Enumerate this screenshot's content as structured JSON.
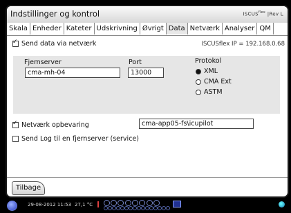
{
  "window": {
    "title": "Indstillinger og kontrol",
    "brand": "ISCUS",
    "brand_sup": "flex",
    "brand_suffix": "|Rev L"
  },
  "tabs": [
    {
      "label": "Skala",
      "active": false
    },
    {
      "label": "Enheder",
      "active": false
    },
    {
      "label": "Kateter",
      "active": false
    },
    {
      "label": "Udskrivning",
      "active": false
    },
    {
      "label": "Øvrigt",
      "active": false
    },
    {
      "label": "Data",
      "active": true
    },
    {
      "label": "Netværk",
      "active": false
    },
    {
      "label": "Analyser",
      "active": false
    },
    {
      "label": "QM",
      "active": false
    }
  ],
  "network": {
    "send_data_label": "Send data via netværk",
    "send_data_checked": true,
    "ip_info": "ISCUSflex IP = 192.168.0.68",
    "server_label": "Fjernserver",
    "server_value": "cma-mh-04",
    "port_label": "Port",
    "port_value": "13000",
    "protocol_label": "Protokol",
    "protocols": [
      {
        "label": "XML",
        "selected": true
      },
      {
        "label": "CMA Ext",
        "selected": false
      },
      {
        "label": "ASTM",
        "selected": false
      }
    ],
    "storage_label": "Netværk opbevaring",
    "storage_checked": true,
    "storage_value": "cma-app05-fs\\icupilot",
    "send_log_label": "Send Log til en fjernserver (service)",
    "send_log_checked": false
  },
  "footer": {
    "back_label": "Tilbage"
  },
  "statusbar": {
    "datetime": "29-08-2012 11:53",
    "temperature": "27,1 °C",
    "alarm_color": "#e04040"
  },
  "icons": {
    "power": "power-icon",
    "alarm": "alarm-indicator-icon",
    "vials": "vial-rack-icon",
    "network": "network-icon",
    "globe": "globe-icon"
  }
}
